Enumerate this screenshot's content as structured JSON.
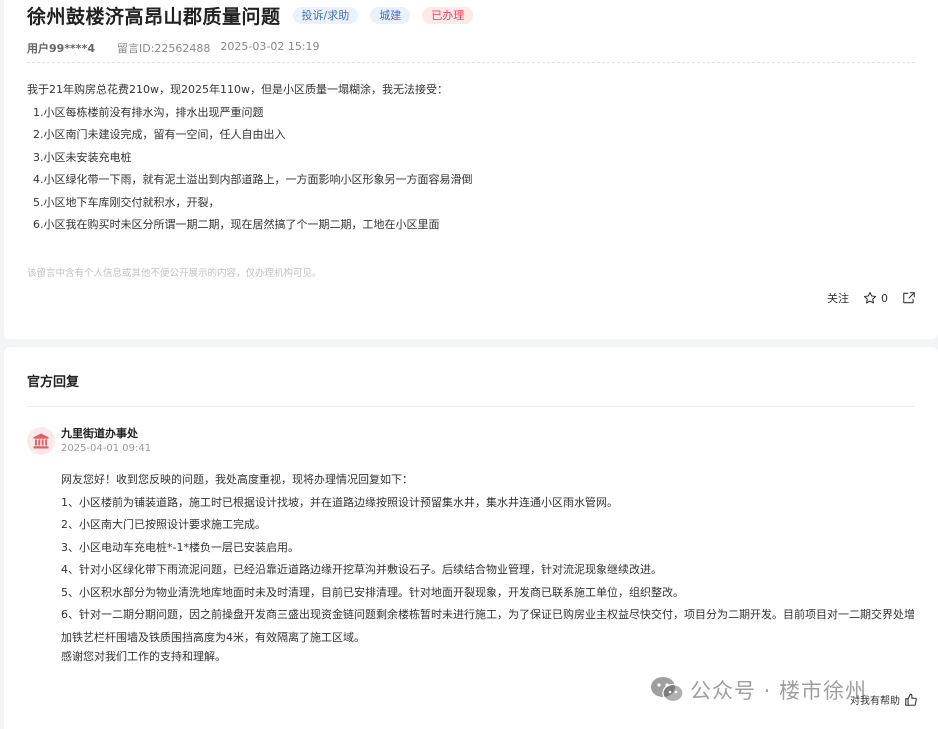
{
  "complaint": {
    "title": "徐州鼓楼济高昂山郡质量问题",
    "tags": [
      {
        "label": "投诉/求助",
        "color": "#4a72b8"
      },
      {
        "label": "城建",
        "color": "#4a72b8"
      },
      {
        "label": "已办理",
        "color": "#e24b5c"
      }
    ],
    "user": "用户99****4",
    "message_id": "留言ID:22562488",
    "datetime": "2025-03-02 15:19",
    "intro": "我于21年购房总花费210w，现2025年110w，但是小区质量一塌糊涂，我无法接受：",
    "items": [
      "1.小区每栋楼前没有排水沟，排水出现严重问题",
      "2.小区南门未建设完成，留有一空间，任人自由出入",
      "3.小区未安装充电桩",
      "4.小区绿化带一下雨，就有泥土溢出到内部道路上，一方面影响小区形象另一方面容易滑倒",
      "5.小区地下车库刚交付就积水，开裂，",
      "6.小区我在购买时未区分所谓一期二期，现在居然搞了个一期二期，工地在小区里面"
    ],
    "privacy_notice": "该留言中含有个人信息或其他不便公开展示的内容，仅办理机构可见。",
    "follow_label": "关注",
    "like_count": "0",
    "icons": {
      "like": "thumb-up-outline-icon",
      "share": "share-icon"
    }
  },
  "reply": {
    "section_title": "官方回复",
    "org_name": "九里街道办事处",
    "org_icon": "government-building-icon",
    "datetime": "2025-04-01 09:41",
    "greeting": "网友您好！收到您反映的问题，我处高度重视，现将办理情况回复如下：",
    "items": [
      "1、小区楼前为铺装道路，施工时已根据设计找坡，并在道路边缘按照设计预留集水井，集水井连通小区雨水管网。",
      "2、小区南大门已按照设计要求施工完成。",
      "3、小区电动车充电桩*-1*楼负一层已安装启用。",
      "4、针对小区绿化带下雨流泥问题，已经沿靠近道路边缘开挖草沟并敷设石子。后续结合物业管理，针对流泥现象继续改进。",
      "5、小区积水部分为物业清洗地库地面时未及时清理，目前已安排清理。针对地面开裂现象，开发商已联系施工单位，组织整改。",
      "6、针对一二期分期问题，因之前操盘开发商三盛出现资金链问题剩余楼栋暂时未进行施工，为了保证已购房业主权益尽快交付，项目分为二期开发。目前项目对一二期交界处增加铁艺栏杆围墙及铁质围挡高度为4米，有效隔离了施工区域。"
    ],
    "closing": "感谢您对我们工作的支持和理解。",
    "helpful_label": "对我有帮助"
  },
  "watermark": {
    "text": "公众号 · 楼市徐州",
    "icon": "wechat-icon"
  }
}
